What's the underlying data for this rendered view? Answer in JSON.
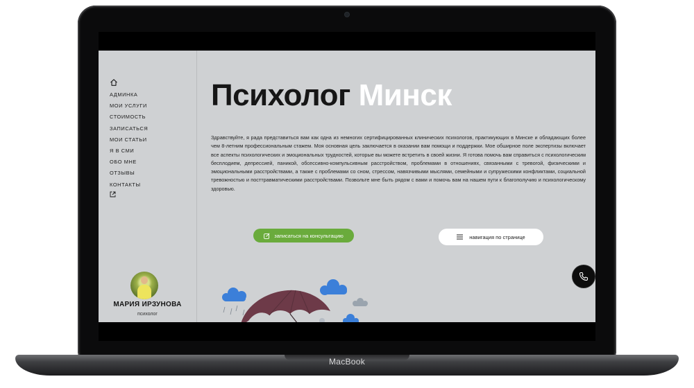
{
  "device": {
    "brand_label": "MacBook"
  },
  "sidebar": {
    "home_icon": "home-icon",
    "items": [
      {
        "label": "АДМИНКА"
      },
      {
        "label": "МОИ УСЛУГИ"
      },
      {
        "label": "СТОИМОСТЬ"
      },
      {
        "label": "ЗАПИСАТЬСЯ"
      },
      {
        "label": "МОИ СТАТЬИ"
      },
      {
        "label": "Я В СМИ"
      },
      {
        "label": "ОБО МНЕ"
      },
      {
        "label": "ОТЗЫВЫ"
      },
      {
        "label": "КОНТАКТЫ"
      }
    ],
    "external_icon": "external-link-icon",
    "profile": {
      "name": "МАРИЯ ИРЗУНОВА",
      "role": "психолог"
    }
  },
  "hero": {
    "title_main": "Психолог",
    "title_city": "Минск",
    "intro": "Здравствуйте, я рада представиться вам как одна из немногих сертифицированных клинических психологов, практикующих в Минске и обладающих более чем 8-летним профессиональным стажем. Моя основная цель заключается в оказании вам помощи и поддержки. Мое обширное поле экспертизы включает все аспекты психологических и эмоциональных трудностей, которые вы можете встретить в своей жизни. Я готова помочь вам справиться с психологическим бесплодием, депрессией, паникой, обсессивно-компульсивным расстройством, проблемами в отношениях, связанными с тревогой, физическими и эмоциональными расстройствами, а также с проблемами со сном, стрессом, навязчивыми мыслями, семейными и супружескими конфликтами, социальной тревожностью и посттравматическими расстройствами. Позвольте мне быть рядом с вами и помочь вам на нашем пути к благополучию и психологическому здоровью."
  },
  "buttons": {
    "book": "записаться на консультацию",
    "page_nav": "навигация по странице"
  },
  "colors": {
    "site_bg": "#cfd1d3",
    "accent_green": "#6aab3c",
    "title_dark": "#161616",
    "title_light": "#ffffff",
    "umbrella": "#6d3a48",
    "cloud": "#3b7fd9"
  },
  "fab": {
    "icon": "phone-icon"
  }
}
